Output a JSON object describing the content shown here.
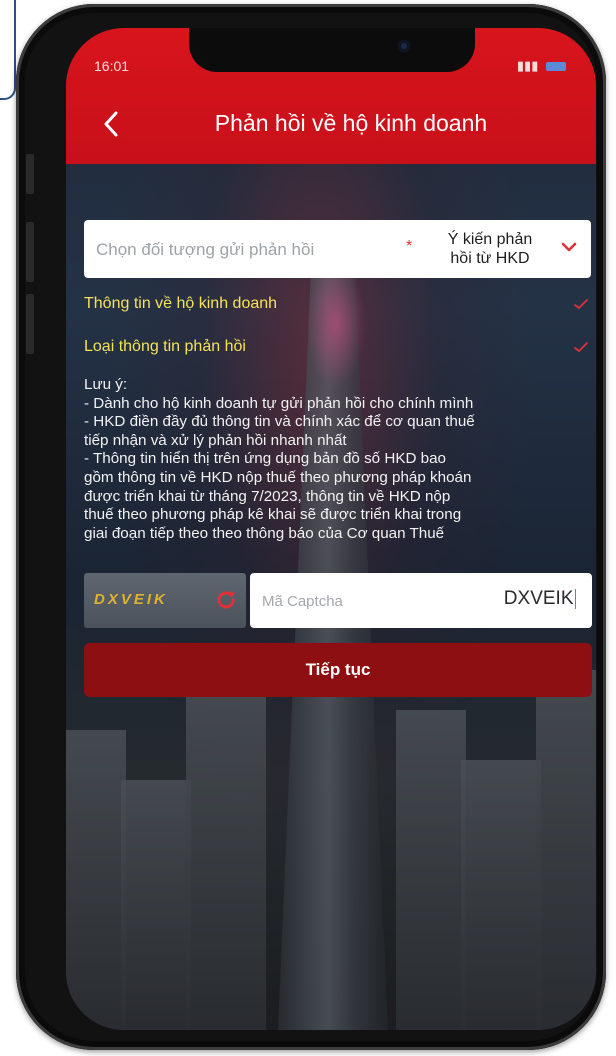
{
  "status_bar": {
    "time": "16:01"
  },
  "header": {
    "title": "Phản hồi về hộ kinh doanh"
  },
  "form": {
    "recipient_select": {
      "placeholder": "Chọn đối tượng gửi phản hồi",
      "required_mark": "*",
      "value_line1": "Ý kiến phản",
      "value_line2": "hồi từ HKD"
    },
    "sections": {
      "business_info": "Thông tin về hộ kinh doanh",
      "feedback_type": "Loại thông tin phản hồi"
    },
    "note_lines": [
      "Lưu ý:",
      "- Dành cho hộ kinh doanh tự gửi phản hồi cho chính mình",
      "- HKD điền đầy đủ thông tin và chính xác để cơ quan thuế",
      "tiếp nhận và xử lý phản hồi nhanh nhất",
      " - Thông tin hiển thị trên ứng dụng bản đồ số HKD bao",
      "gồm thông tin về HKD nộp thuế theo phương pháp khoán",
      "được triển khai từ tháng 7/2023, thông tin về HKD nộp",
      "thuế theo phương pháp kê khai sẽ được triển khai trong",
      "giai đoạn tiếp theo theo thông báo của Cơ quan Thuế"
    ],
    "captcha": {
      "image_text": "DXVEIK",
      "placeholder": "Mã Captcha",
      "value": "DXVEIK"
    },
    "continue_label": "Tiếp tục"
  },
  "colors": {
    "header_red": "#d8141c",
    "button_dark_red": "#8e0f12",
    "section_yellow": "#f4e25a",
    "accent_red": "#e0303a"
  },
  "icons": [
    "back-arrow-icon",
    "chevron-down-icon",
    "check-icon",
    "refresh-icon"
  ]
}
